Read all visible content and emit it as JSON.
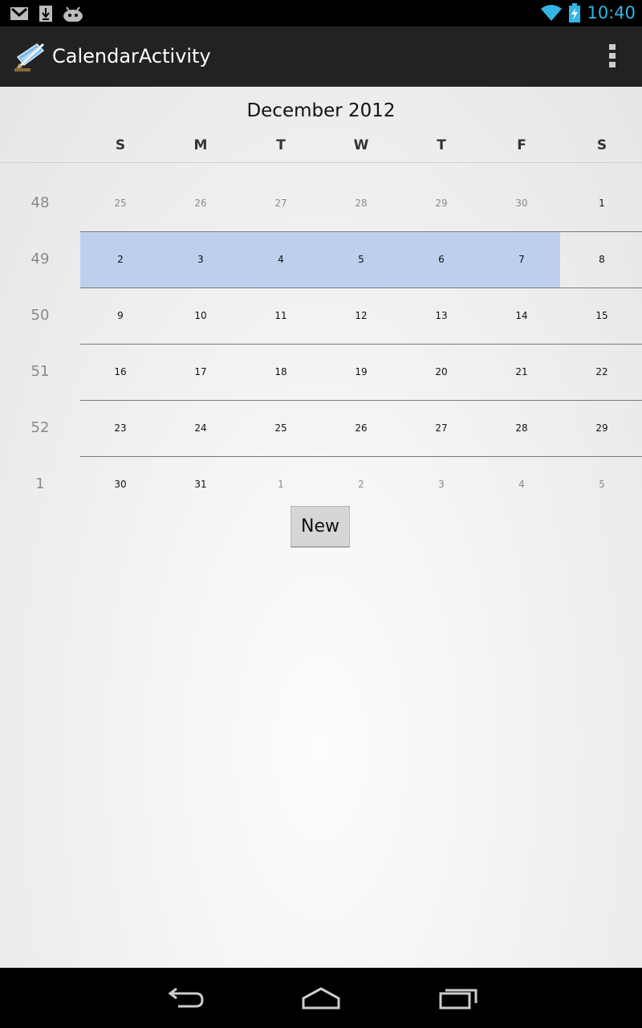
{
  "status_bar": {
    "time": "10:40",
    "left_icons": [
      "gmail-icon",
      "download-icon",
      "android-icon"
    ],
    "right_icons": [
      "wifi-icon",
      "battery-charging-icon"
    ],
    "accent": "#33b5e5"
  },
  "action_bar": {
    "title": "CalendarActivity",
    "app_icon": "paintbrush-app-icon",
    "overflow_icon": "overflow-menu-icon"
  },
  "calendar": {
    "month_title": "December 2012",
    "weekdays": [
      "S",
      "M",
      "T",
      "W",
      "T",
      "F",
      "S"
    ],
    "highlight_color": "#bcd0ee",
    "selected_week_index": 1,
    "weeks": [
      {
        "number": "48",
        "days": [
          {
            "d": "25",
            "other": true
          },
          {
            "d": "26",
            "other": true
          },
          {
            "d": "27",
            "other": true
          },
          {
            "d": "28",
            "other": true
          },
          {
            "d": "29",
            "other": true
          },
          {
            "d": "30",
            "other": true
          },
          {
            "d": "1",
            "other": false
          }
        ]
      },
      {
        "number": "49",
        "days": [
          {
            "d": "2",
            "other": false
          },
          {
            "d": "3",
            "other": false
          },
          {
            "d": "4",
            "other": false
          },
          {
            "d": "5",
            "other": false
          },
          {
            "d": "6",
            "other": false
          },
          {
            "d": "7",
            "other": false
          },
          {
            "d": "8",
            "other": false
          }
        ]
      },
      {
        "number": "50",
        "days": [
          {
            "d": "9",
            "other": false
          },
          {
            "d": "10",
            "other": false
          },
          {
            "d": "11",
            "other": false
          },
          {
            "d": "12",
            "other": false
          },
          {
            "d": "13",
            "other": false
          },
          {
            "d": "14",
            "other": false
          },
          {
            "d": "15",
            "other": false
          }
        ]
      },
      {
        "number": "51",
        "days": [
          {
            "d": "16",
            "other": false
          },
          {
            "d": "17",
            "other": false
          },
          {
            "d": "18",
            "other": false
          },
          {
            "d": "19",
            "other": false
          },
          {
            "d": "20",
            "other": false
          },
          {
            "d": "21",
            "other": false
          },
          {
            "d": "22",
            "other": false
          }
        ]
      },
      {
        "number": "52",
        "days": [
          {
            "d": "23",
            "other": false
          },
          {
            "d": "24",
            "other": false
          },
          {
            "d": "25",
            "other": false
          },
          {
            "d": "26",
            "other": false
          },
          {
            "d": "27",
            "other": false
          },
          {
            "d": "28",
            "other": false
          },
          {
            "d": "29",
            "other": false
          }
        ]
      },
      {
        "number": "1",
        "days": [
          {
            "d": "30",
            "other": false
          },
          {
            "d": "31",
            "other": false
          },
          {
            "d": "1",
            "other": true
          },
          {
            "d": "2",
            "other": true
          },
          {
            "d": "3",
            "other": true
          },
          {
            "d": "4",
            "other": true
          },
          {
            "d": "5",
            "other": true
          }
        ]
      }
    ]
  },
  "new_button": {
    "label": "New"
  },
  "nav_bar": {
    "buttons": [
      "back-icon",
      "home-icon",
      "recent-apps-icon"
    ]
  }
}
